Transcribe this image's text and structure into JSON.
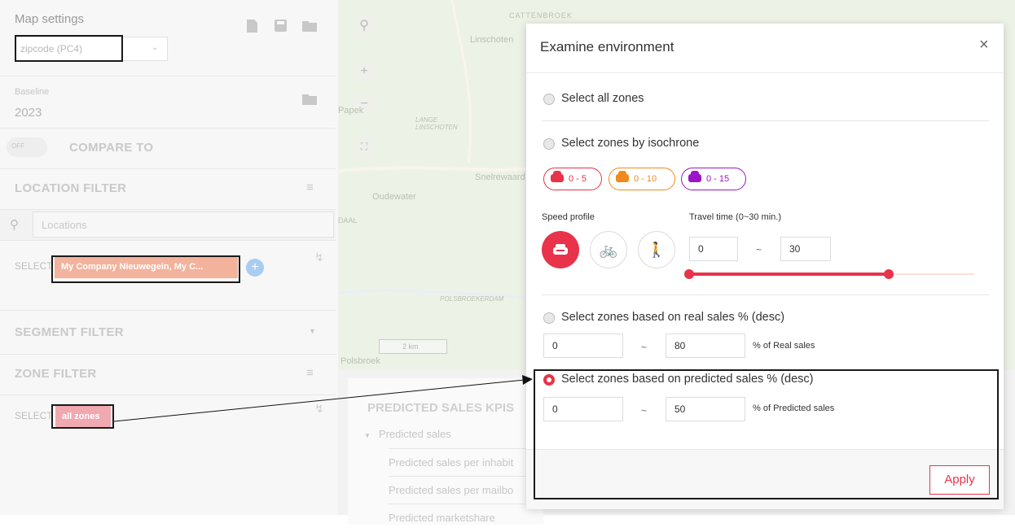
{
  "left_panel": {
    "map_settings_title": "Map settings",
    "zone_select_value": "zipcode (PC4)",
    "baseline_label": "Baseline",
    "baseline_value": "2023",
    "toggle_label": "OFF",
    "compare_to": "COMPARE TO",
    "location_filter": "LOCATION FILTER",
    "locations_placeholder": "Locations",
    "select_label": "SELECT",
    "location_tag": "My Company Nieuwegein, My C...",
    "segment_filter": "SEGMENT FILTER",
    "zone_filter": "ZONE FILTER",
    "zone_tag": "all zones"
  },
  "map": {
    "labels": [
      "CATTENBROEK",
      "Linschoten",
      "LANGE LINSCHOTEN",
      "Snelrewaard",
      "Oudewater",
      "POLSBROEKERDAM",
      "Polsbroek",
      "Papek",
      "DAAL"
    ],
    "scale": "2 km"
  },
  "kpis": {
    "title": "PREDICTED SALES KPIS",
    "rows": [
      "Predicted sales",
      "Predicted sales per inhabit",
      "Predicted sales per mailbo",
      "Predicted marketshare"
    ]
  },
  "modal": {
    "title": "Examine environment",
    "close": "×",
    "opt_all": "Select all zones",
    "opt_isochrone": "Select zones by isochrone",
    "pills": [
      {
        "label": "0 - 5",
        "color": "#e8334a"
      },
      {
        "label": "0 - 10",
        "color": "#f08a1c"
      },
      {
        "label": "0 - 15",
        "color": "#9a16c7"
      }
    ],
    "speed_profile": "Speed profile",
    "travel_time": "Travel time (0~30 min.)",
    "travel_min": "0",
    "travel_max": "30",
    "tilde": "~",
    "travel_slider": {
      "min": 0,
      "max": 30,
      "low": 0,
      "high": 21
    },
    "opt_real": "Select zones based on real sales % (desc)",
    "real_min": "0",
    "real_max": "80",
    "real_unit": "% of Real sales",
    "opt_predicted": "Select zones based on predicted sales % (desc)",
    "pred_min": "0",
    "pred_max": "50",
    "pred_unit": "% of Predicted sales",
    "apply": "Apply"
  },
  "colors": {
    "accent": "#e8334a",
    "tag_location": "#f3b29c",
    "tag_zone": "#f0a9b0"
  }
}
